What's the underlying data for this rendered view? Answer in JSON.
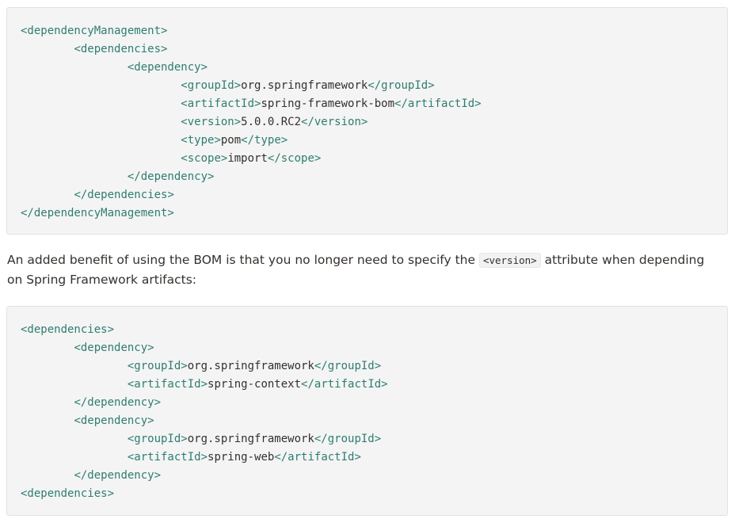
{
  "code_block_1": {
    "lines": [
      [
        {
          "t": "tag",
          "s": "<dependencyManagement>"
        }
      ],
      [
        {
          "t": "txt",
          "s": "        "
        },
        {
          "t": "tag",
          "s": "<dependencies>"
        }
      ],
      [
        {
          "t": "txt",
          "s": "                "
        },
        {
          "t": "tag",
          "s": "<dependency>"
        }
      ],
      [
        {
          "t": "txt",
          "s": "                        "
        },
        {
          "t": "tag",
          "s": "<groupId>"
        },
        {
          "t": "txt",
          "s": "org.springframework"
        },
        {
          "t": "tag",
          "s": "</groupId>"
        }
      ],
      [
        {
          "t": "txt",
          "s": "                        "
        },
        {
          "t": "tag",
          "s": "<artifactId>"
        },
        {
          "t": "txt",
          "s": "spring-framework-bom"
        },
        {
          "t": "tag",
          "s": "</artifactId>"
        }
      ],
      [
        {
          "t": "txt",
          "s": "                        "
        },
        {
          "t": "tag",
          "s": "<version>"
        },
        {
          "t": "txt",
          "s": "5.0.0.RC2"
        },
        {
          "t": "tag",
          "s": "</version>"
        }
      ],
      [
        {
          "t": "txt",
          "s": "                        "
        },
        {
          "t": "tag",
          "s": "<type>"
        },
        {
          "t": "txt",
          "s": "pom"
        },
        {
          "t": "tag",
          "s": "</type>"
        }
      ],
      [
        {
          "t": "txt",
          "s": "                        "
        },
        {
          "t": "tag",
          "s": "<scope>"
        },
        {
          "t": "txt",
          "s": "import"
        },
        {
          "t": "tag",
          "s": "</scope>"
        }
      ],
      [
        {
          "t": "txt",
          "s": "                "
        },
        {
          "t": "tag",
          "s": "</dependency>"
        }
      ],
      [
        {
          "t": "txt",
          "s": "        "
        },
        {
          "t": "tag",
          "s": "</dependencies>"
        }
      ],
      [
        {
          "t": "tag",
          "s": "</dependencyManagement>"
        }
      ]
    ]
  },
  "paragraph": {
    "before": "An added benefit of using the BOM is that you no longer need to specify the ",
    "code": "<version>",
    "after": " attribute when depending on Spring Framework artifacts:"
  },
  "code_block_2": {
    "lines": [
      [
        {
          "t": "tag",
          "s": "<dependencies>"
        }
      ],
      [
        {
          "t": "txt",
          "s": "        "
        },
        {
          "t": "tag",
          "s": "<dependency>"
        }
      ],
      [
        {
          "t": "txt",
          "s": "                "
        },
        {
          "t": "tag",
          "s": "<groupId>"
        },
        {
          "t": "txt",
          "s": "org.springframework"
        },
        {
          "t": "tag",
          "s": "</groupId>"
        }
      ],
      [
        {
          "t": "txt",
          "s": "                "
        },
        {
          "t": "tag",
          "s": "<artifactId>"
        },
        {
          "t": "txt",
          "s": "spring-context"
        },
        {
          "t": "tag",
          "s": "</artifactId>"
        }
      ],
      [
        {
          "t": "txt",
          "s": "        "
        },
        {
          "t": "tag",
          "s": "</dependency>"
        }
      ],
      [
        {
          "t": "txt",
          "s": "        "
        },
        {
          "t": "tag",
          "s": "<dependency>"
        }
      ],
      [
        {
          "t": "txt",
          "s": "                "
        },
        {
          "t": "tag",
          "s": "<groupId>"
        },
        {
          "t": "txt",
          "s": "org.springframework"
        },
        {
          "t": "tag",
          "s": "</groupId>"
        }
      ],
      [
        {
          "t": "txt",
          "s": "                "
        },
        {
          "t": "tag",
          "s": "<artifactId>"
        },
        {
          "t": "txt",
          "s": "spring-web"
        },
        {
          "t": "tag",
          "s": "</artifactId>"
        }
      ],
      [
        {
          "t": "txt",
          "s": "        "
        },
        {
          "t": "tag",
          "s": "</dependency>"
        }
      ],
      [
        {
          "t": "tag",
          "s": "<dependencies>"
        }
      ]
    ]
  },
  "colors": {
    "tag": "#2e7d6f",
    "text": "#34302d",
    "code_background": "#f4f4f4"
  }
}
